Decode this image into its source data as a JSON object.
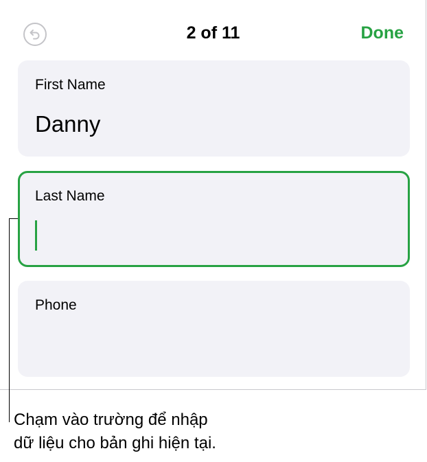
{
  "header": {
    "back_icon": "undo-arrow-icon",
    "counter": "2 of 11",
    "done_label": "Done"
  },
  "colors": {
    "accent": "#27a243",
    "field_background": "#f2f2f7",
    "disabled_icon": "#c4c4c8"
  },
  "fields": [
    {
      "label": "First Name",
      "value": "Danny"
    },
    {
      "label": "Last Name",
      "value": ""
    },
    {
      "label": "Phone",
      "value": ""
    }
  ],
  "callout": {
    "line1": "Chạm vào trường để nhập",
    "line2": "dữ liệu cho bản ghi hiện tại."
  }
}
